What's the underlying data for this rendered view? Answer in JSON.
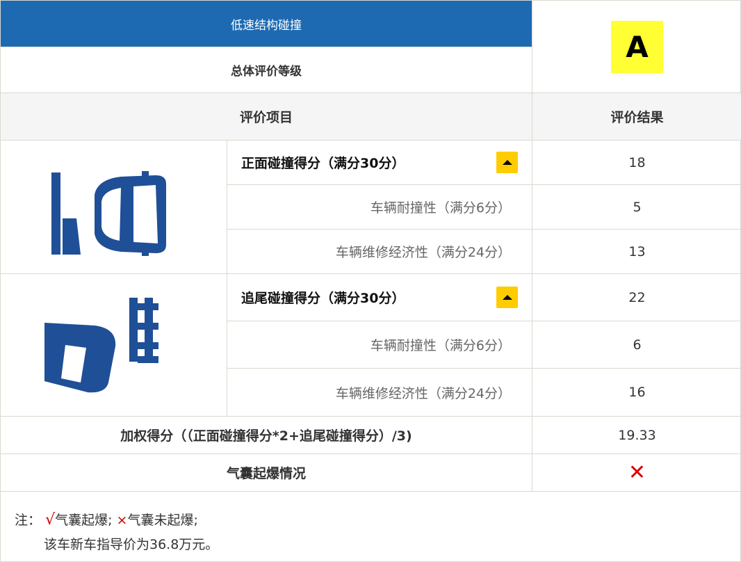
{
  "header": {
    "title": "低速结构碰撞",
    "overall_label": "总体评价等级",
    "grade": "A"
  },
  "columns": {
    "item": "评价项目",
    "result": "评价结果"
  },
  "front": {
    "icon": "front-crash-car-icon",
    "title": "正面碰撞得分（满分30分）",
    "score": "18",
    "rows": [
      {
        "label": "车辆耐撞性（满分6分）",
        "value": "5"
      },
      {
        "label": "车辆维修经济性（满分24分）",
        "value": "13"
      }
    ]
  },
  "rear": {
    "icon": "rear-crash-car-icon",
    "title": "追尾碰撞得分（满分30分）",
    "score": "22",
    "rows": [
      {
        "label": "车辆耐撞性（满分6分）",
        "value": "6"
      },
      {
        "label": "车辆维修经济性（满分24分）",
        "value": "16"
      }
    ]
  },
  "weighted": {
    "label": "加权得分（（正面碰撞得分*2+追尾碰撞得分）/3)",
    "value": "19.33"
  },
  "airbag": {
    "label": "气囊起爆情况",
    "value": "✕"
  },
  "note": {
    "prefix": "注：",
    "check": "√",
    "check_text": "气囊起爆;",
    "cross": "×",
    "cross_text": "气囊未起爆;",
    "price": "该车新车指导价为36.8万元。"
  },
  "colors": {
    "header_blue": "#1e6ab2",
    "grade_yellow": "#ffff33",
    "badge_yellow": "#ffcc00",
    "car_blue": "#1f4f96",
    "red": "#d40000"
  }
}
